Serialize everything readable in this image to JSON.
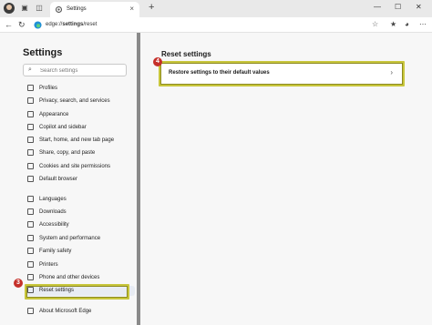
{
  "browser": {
    "tab_title": "Settings",
    "new_tab": "+",
    "url_prefix": "edge://",
    "url_bold": "settings",
    "url_suffix": "/reset"
  },
  "sidebar": {
    "title": "Settings",
    "search_placeholder": "Search settings",
    "items": [
      {
        "label": "Profiles",
        "icon": "profile-icon"
      },
      {
        "label": "Privacy, search, and services",
        "icon": "lock-icon"
      },
      {
        "label": "Appearance",
        "icon": "appearance-icon"
      },
      {
        "label": "Copilot and sidebar",
        "icon": "sidebar-icon"
      },
      {
        "label": "Start, home, and new tab page",
        "icon": "home-icon"
      },
      {
        "label": "Share, copy, and paste",
        "icon": "share-icon"
      },
      {
        "label": "Cookies and site permissions",
        "icon": "cookies-icon"
      },
      {
        "label": "Default browser",
        "icon": "browser-icon"
      },
      {
        "label": "Languages",
        "icon": "languages-icon"
      },
      {
        "label": "Downloads",
        "icon": "download-icon"
      },
      {
        "label": "Accessibility",
        "icon": "accessibility-icon"
      },
      {
        "label": "System and performance",
        "icon": "system-icon"
      },
      {
        "label": "Family safety",
        "icon": "family-icon"
      },
      {
        "label": "Printers",
        "icon": "printer-icon"
      },
      {
        "label": "Phone and other devices",
        "icon": "phone-icon"
      },
      {
        "label": "Reset settings",
        "icon": "reset-icon",
        "active": true
      },
      {
        "label": "About Microsoft Edge",
        "icon": "edge-icon"
      }
    ]
  },
  "main": {
    "section_title": "Reset settings",
    "restore_label": "Restore settings to their default values"
  },
  "badges": {
    "step_reset": "3",
    "step_restore": "4"
  },
  "colors": {
    "highlight": "#c8c63c",
    "badge": "#c5302a",
    "accent": "#0f6cbd"
  }
}
